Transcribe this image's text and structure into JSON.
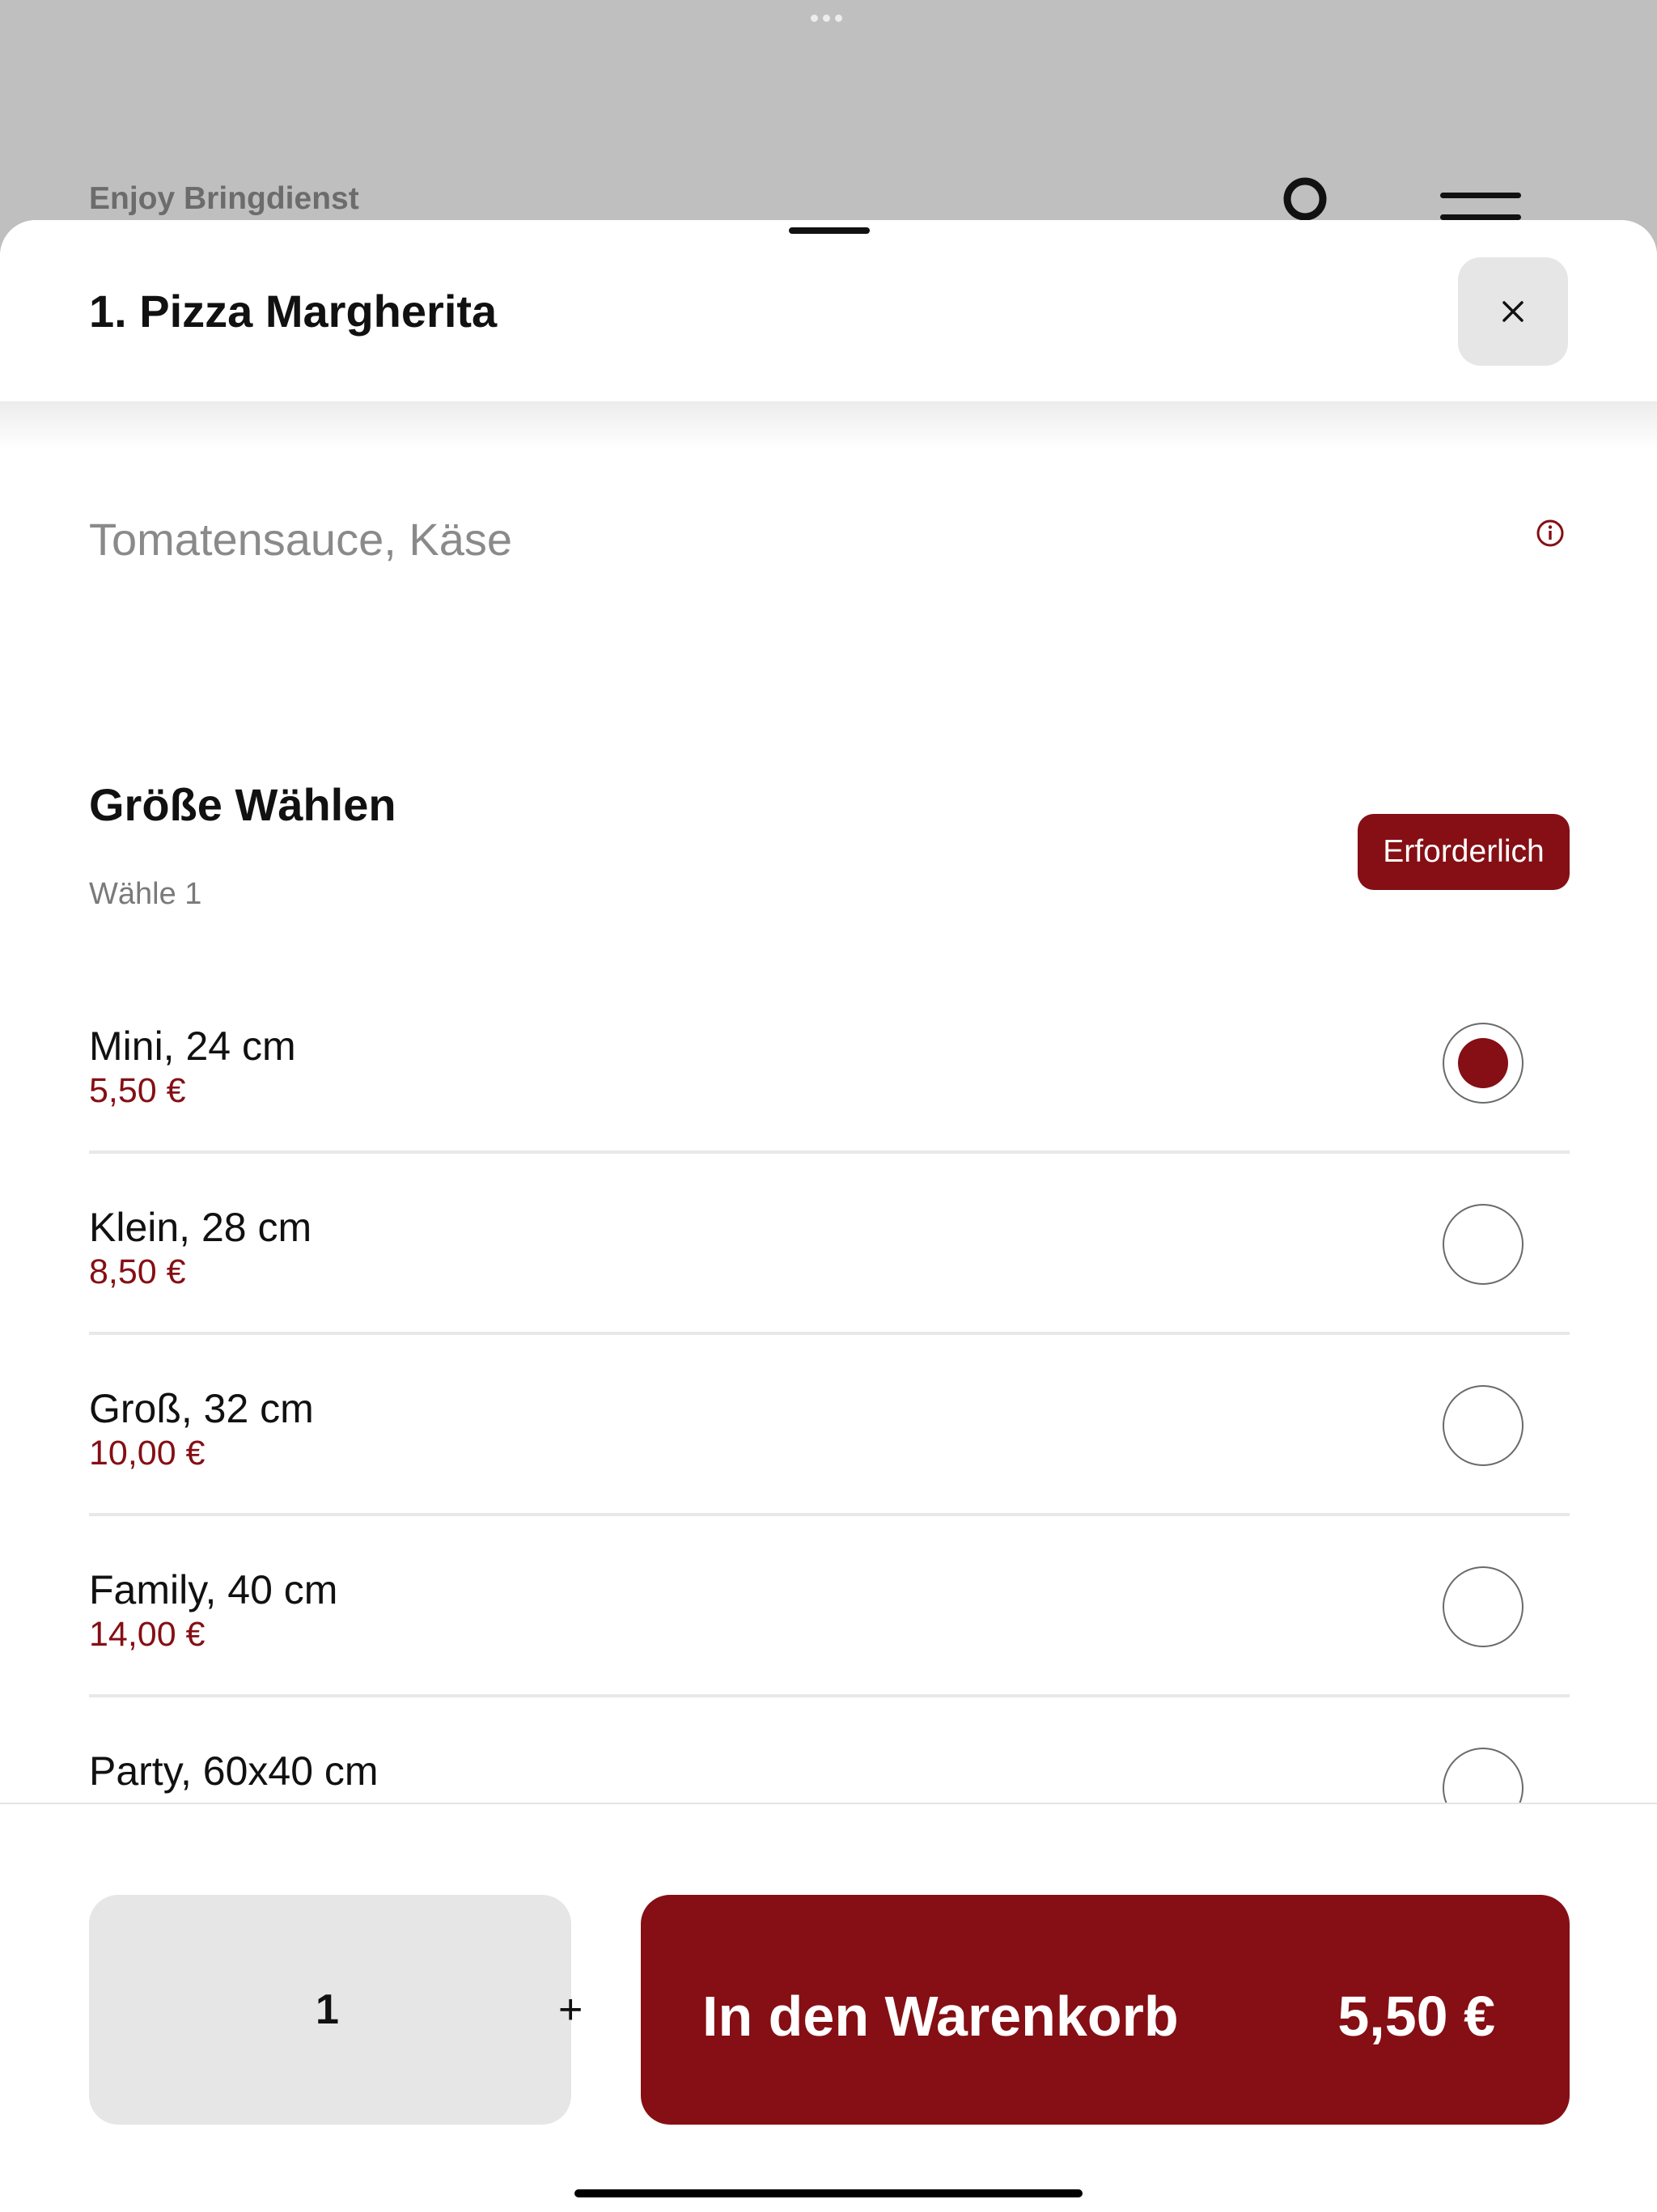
{
  "background": {
    "app_name": "Enjoy Bringdienst"
  },
  "modal": {
    "title": "1. Pizza Margherita",
    "close_label": "×",
    "description": "Tomatensauce, Käse",
    "size_section": {
      "title": "Größe Wählen",
      "subtitle": "Wähle 1",
      "badge": "Erforderlich",
      "options": [
        {
          "name": "Mini, 24 cm",
          "price": "5,50 €",
          "selected": true
        },
        {
          "name": "Klein, 28 cm",
          "price": "8,50 €",
          "selected": false
        },
        {
          "name": "Groß, 32 cm",
          "price": "10,00 €",
          "selected": false
        },
        {
          "name": "Family, 40 cm",
          "price": "14,00 €",
          "selected": false
        },
        {
          "name": "Party, 60x40 cm",
          "price": "",
          "selected": false
        }
      ]
    }
  },
  "footer": {
    "quantity": "1",
    "plus_label": "+",
    "add_label": "In den Warenkorb",
    "total": "5,50 €"
  },
  "colors": {
    "accent": "#850f14",
    "overlay": "#bfbfbf"
  },
  "icons": [
    "info-icon",
    "close-icon",
    "user-icon",
    "menu-icon"
  ]
}
